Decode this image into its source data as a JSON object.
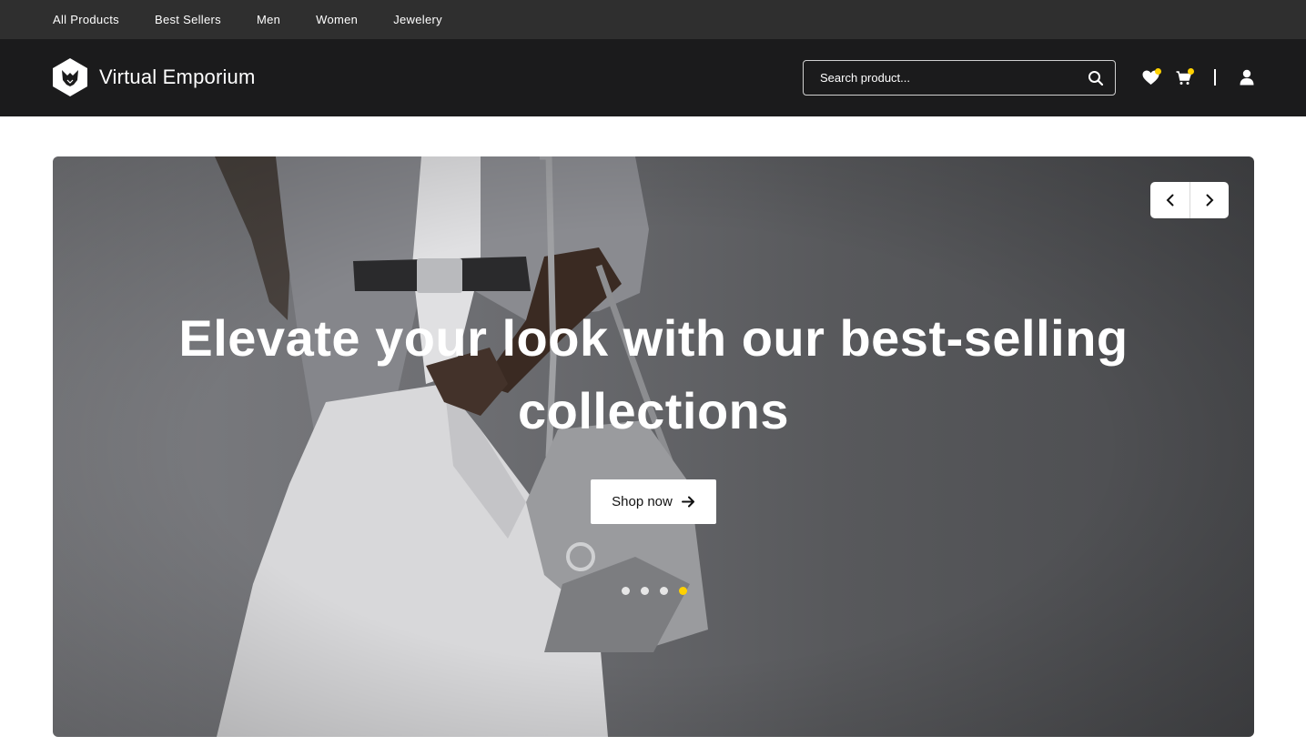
{
  "topnav": {
    "items": [
      "All Products",
      "Best Sellers",
      "Men",
      "Women",
      "Jewelery"
    ]
  },
  "header": {
    "brand": "Virtual Emporium",
    "search_placeholder": "Search product...",
    "icons": [
      "heart-icon",
      "cart-icon",
      "user-icon",
      "search-icon"
    ],
    "badge_color": "#ffd100"
  },
  "hero": {
    "headline": "Elevate your look with our best-selling collections",
    "cta_label": "Shop now",
    "slides_count": 4,
    "active_slide": 4
  },
  "colors": {
    "topnav_bg": "#2f2f2f",
    "header_bg": "#1b1b1c",
    "accent": "#ffd100"
  }
}
